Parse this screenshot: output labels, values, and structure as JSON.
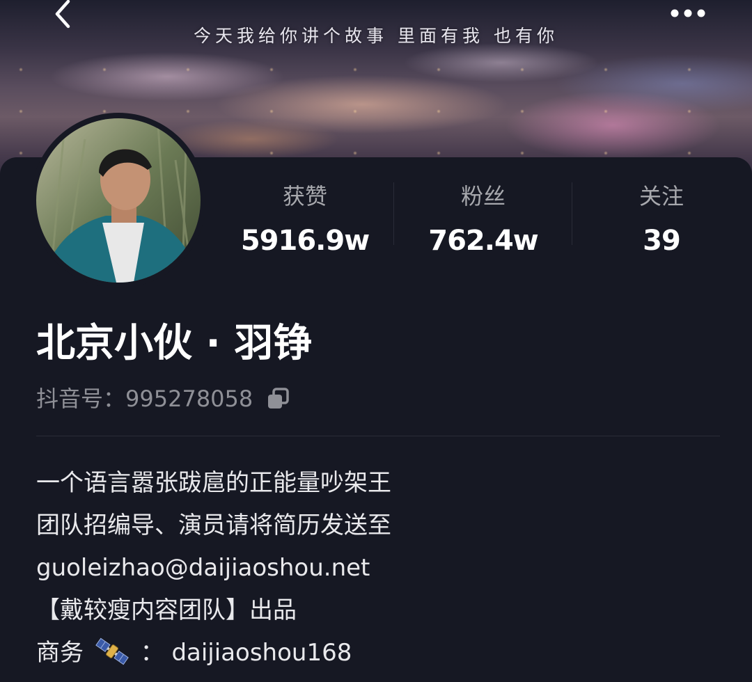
{
  "header": {
    "back_icon": "chevron-left-icon",
    "more_icon": "more-horizontal-icon",
    "banner_slogan": "今天我给你讲个故事 里面有我 也有你"
  },
  "profile": {
    "avatar_icon": "avatar",
    "name": "北京小伙 · 羽铮",
    "douyin_id_label": "抖音号：",
    "douyin_id": "995278058",
    "copy_icon": "copy-icon"
  },
  "stats": [
    {
      "label": "获赞",
      "value": "5916.9w"
    },
    {
      "label": "粉丝",
      "value": "762.4w"
    },
    {
      "label": "关注",
      "value": "39"
    }
  ],
  "bio": {
    "lines": [
      "一个语言嚣张跋扈的正能量吵架王",
      "团队招编导、演员请将简历发送至",
      "guoleizhao@daijiaoshou.net",
      "【戴较瘦内容团队】出品"
    ],
    "business_prefix": "商务",
    "business_icon": "satellite-icon",
    "business_sep": "：",
    "business_value": "daijiaoshou168"
  },
  "colors": {
    "background": "#161823",
    "primary_text": "#ffffff",
    "secondary_text": "#a7a8ad",
    "muted_text": "#8f9097"
  }
}
